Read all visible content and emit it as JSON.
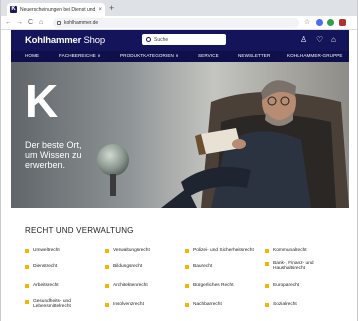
{
  "browser": {
    "tab_title": "Neuerscheinungen bei Dienst und...",
    "tab_close": "×",
    "new_tab": "+",
    "url": "kohlhammer.de",
    "back": "←",
    "forward": "→",
    "reload": "C",
    "home": "⌂",
    "star": "☆",
    "colors": {
      "ext1": "#4a6cf7",
      "ext2": "#2e9f4e",
      "ext3": "#b03030"
    }
  },
  "site": {
    "logo_brand": "Kohlhammer",
    "logo_shop": " Shop",
    "search_placeholder": "Suche",
    "header_icons": {
      "account": "♙",
      "wishlist": "♡",
      "cart": "⌂"
    }
  },
  "nav": [
    "HOME",
    "FACHBEREICHE ∨",
    "PRODUKTKATEGORIEN ∨",
    "SERVICE",
    "NEWSLETTER",
    "KOHLHAMMER-GRUPPE"
  ],
  "hero": {
    "letter": "K",
    "claim": [
      "Der beste Ort,",
      "um Wissen zu",
      "erwerben."
    ]
  },
  "section": {
    "title": "RECHT UND VERWALTUNG",
    "categories": [
      [
        "Umweltrecht",
        "Verwaltungsrecht",
        "Polizei- und Sicherheitsrecht",
        "Kommunalrecht"
      ],
      [
        "Dienstrecht",
        "Bildungsrecht",
        "Baurecht",
        "Bank-, Finanz- und Haushaltsrecht"
      ],
      [
        "Arbeitsrecht",
        "Architektenrecht",
        "Bürgerliches Recht",
        "Europarecht"
      ],
      [
        "Gesundheits- und Lebensmittelrecht",
        "Insolvenzrecht",
        "Nachbarrecht",
        "Sozialrecht"
      ]
    ],
    "bullet_color": "#f2b705"
  }
}
